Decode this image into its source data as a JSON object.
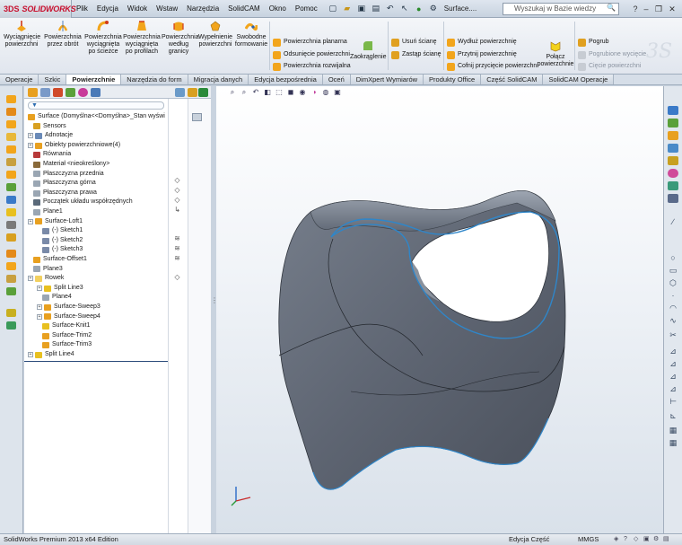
{
  "app": {
    "logo_ds": "3DS",
    "logo_name": "SOLIDWORKS",
    "document_title": "Surface....",
    "menu": [
      "Plik",
      "Edycja",
      "Widok",
      "Wstaw",
      "Narzędzia",
      "SolidCAM",
      "Okno",
      "Pomoc"
    ],
    "search_placeholder": "Wyszukaj w Bazie wiedzy"
  },
  "command_manager": {
    "big_buttons": [
      {
        "line1": "Wyciągnięcie",
        "line2": "powierzchni",
        "line3": "",
        "line4": ""
      },
      {
        "line1": "Powierzchnia",
        "line2": "przez obrót",
        "line3": "",
        "line4": ""
      },
      {
        "line1": "Powierzchnia",
        "line2": "wyciągnięta",
        "line3": "po ścieżce",
        "line4": ""
      },
      {
        "line1": "Powierzchnia",
        "line2": "wyciągnięta",
        "line3": "po profilach",
        "line4": ""
      },
      {
        "line1": "Powierzchnia",
        "line2": "według",
        "line3": "granicy",
        "line4": ""
      },
      {
        "line1": "Wypełnienie",
        "line2": "powierzchni",
        "line3": "",
        "line4": ""
      },
      {
        "line1": "Swobodne",
        "line2": "formowanie",
        "line3": "",
        "line4": ""
      }
    ],
    "col1": [
      "Powierzchnia planarna",
      "Odsunięcie powierzchni",
      "Powierzchnia rozwijalna"
    ],
    "zaokraglenie": "Zaokrąglenie",
    "col2": [
      "Usuń ścianę",
      "Zastąp ścianę"
    ],
    "col3": [
      "Wydłuż powierzchnię",
      "Przytnij powierzchnię",
      "Cofnij przycięcie powierzchni"
    ],
    "polacz": {
      "line1": "Połącz",
      "line2": "powierzchnie"
    },
    "col4": [
      "Pogrub",
      "Pogrubione wycięcie",
      "Cięcie powierzchni"
    ]
  },
  "tabs": [
    "Operacje",
    "Szkic",
    "Powierzchnie",
    "Narzędzia do form",
    "Migracja danych",
    "Edycja bezpośrednia",
    "Oceń",
    "DimXpert Wymiarów",
    "Produkty Office",
    "Część SolidCAM",
    "SolidCAM Operacje"
  ],
  "active_tab": "Powierzchnie",
  "feature_tree": {
    "root": "Surface  (Domyślna<<Domyślna>_Stan wyświ",
    "items": [
      {
        "label": "Sensors"
      },
      {
        "label": "Adnotacje"
      },
      {
        "label": "Obiekty powierzchniowe(4)"
      },
      {
        "label": "Równania"
      },
      {
        "label": "Materiał <nieokreślony>"
      },
      {
        "label": "Płaszczyzna przednia"
      },
      {
        "label": "Płaszczyzna górna"
      },
      {
        "label": "Płaszczyzna prawa"
      },
      {
        "label": "Początek układu współrzędnych"
      },
      {
        "label": "Plane1"
      },
      {
        "label": "Surface-Loft1"
      },
      {
        "label": "(-) Sketch1"
      },
      {
        "label": "(-) Sketch2"
      },
      {
        "label": "(-) Sketch3"
      },
      {
        "label": "Surface-Offset1"
      },
      {
        "label": "Plane3"
      },
      {
        "label": "Rowek"
      },
      {
        "label": "Split Line3"
      },
      {
        "label": "Plane4"
      },
      {
        "label": "Surface-Sweep3"
      },
      {
        "label": "Surface-Sweep4"
      },
      {
        "label": "Surface-Knit1"
      },
      {
        "label": "Surface-Trim2"
      },
      {
        "label": "Surface-Trim3"
      },
      {
        "label": "Split Line4"
      }
    ]
  },
  "status": {
    "product": "SolidWorks Premium 2013 x64 Edition",
    "mode": "Edycja Część",
    "units": "MMGS"
  },
  "colors": {
    "surface": "#5e6572",
    "edge_highlight": "#2f86c9",
    "active_tab_bg": "#ffffff"
  }
}
